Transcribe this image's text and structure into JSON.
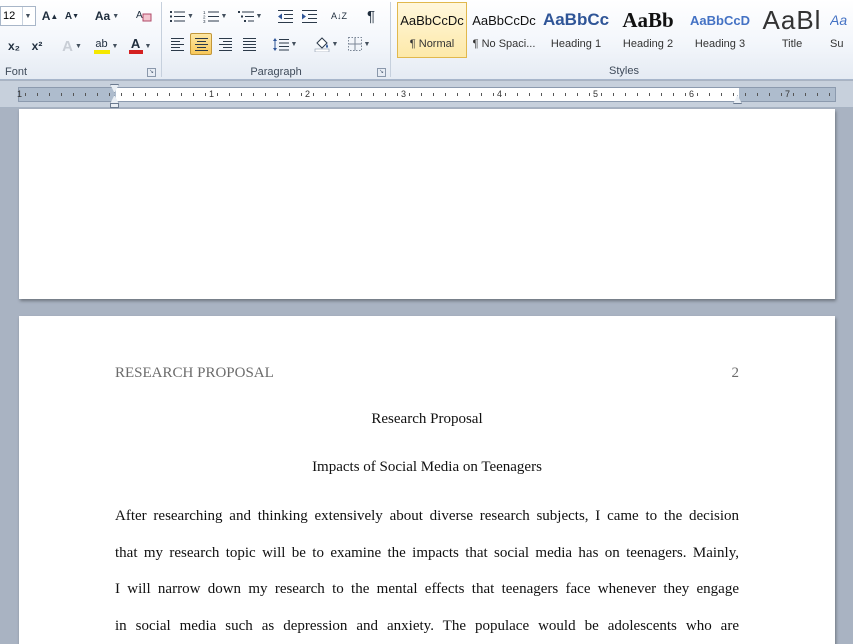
{
  "ribbon": {
    "font": {
      "size": "12",
      "grow_label": "A",
      "shrink_label": "A",
      "change_case_label": "Aa",
      "subscript_label": "x₂",
      "superscript_label": "x²",
      "text_effects_label": "A",
      "highlight_label": "ab",
      "font_color_label": "A",
      "group_label": "Font"
    },
    "paragraph": {
      "group_label": "Paragraph",
      "show_marks_label": "¶",
      "sort_label": "A↓Z"
    },
    "styles": {
      "group_label": "Styles",
      "items": [
        {
          "sample": "AaBbCcDc",
          "name": "¶ Normal"
        },
        {
          "sample": "AaBbCcDc",
          "name": "¶ No Spaci..."
        },
        {
          "sample": "AaBbCc",
          "name": "Heading 1"
        },
        {
          "sample": "AaBb",
          "name": "Heading 2"
        },
        {
          "sample": "AaBbCcD",
          "name": "Heading 3"
        },
        {
          "sample": "AaBl",
          "name": "Title"
        },
        {
          "sample": "Aa",
          "name": "Su"
        }
      ]
    },
    "colors": {
      "highlight": "#f5e800",
      "font_color": "#d42020",
      "heading_blue": "#2f5597",
      "active_border": "#c2973a"
    }
  },
  "ruler": {
    "numbers": [
      "1",
      "1",
      "2",
      "3",
      "4",
      "5",
      "6",
      "7"
    ]
  },
  "document": {
    "running_head": "RESEARCH PROPOSAL",
    "page_number": "2",
    "title": "Research Proposal",
    "subtitle": "Impacts of Social Media on Teenagers",
    "lines": [
      "After researching and thinking extensively about diverse research subjects, I came to the decision",
      "that my research topic will be to examine the impacts that social media has on teenagers. Mainly,",
      "I will narrow down my research to the mental effects that teenagers face whenever they engage",
      "in social media such as depression and anxiety. The populace would be adolescents who are"
    ]
  }
}
